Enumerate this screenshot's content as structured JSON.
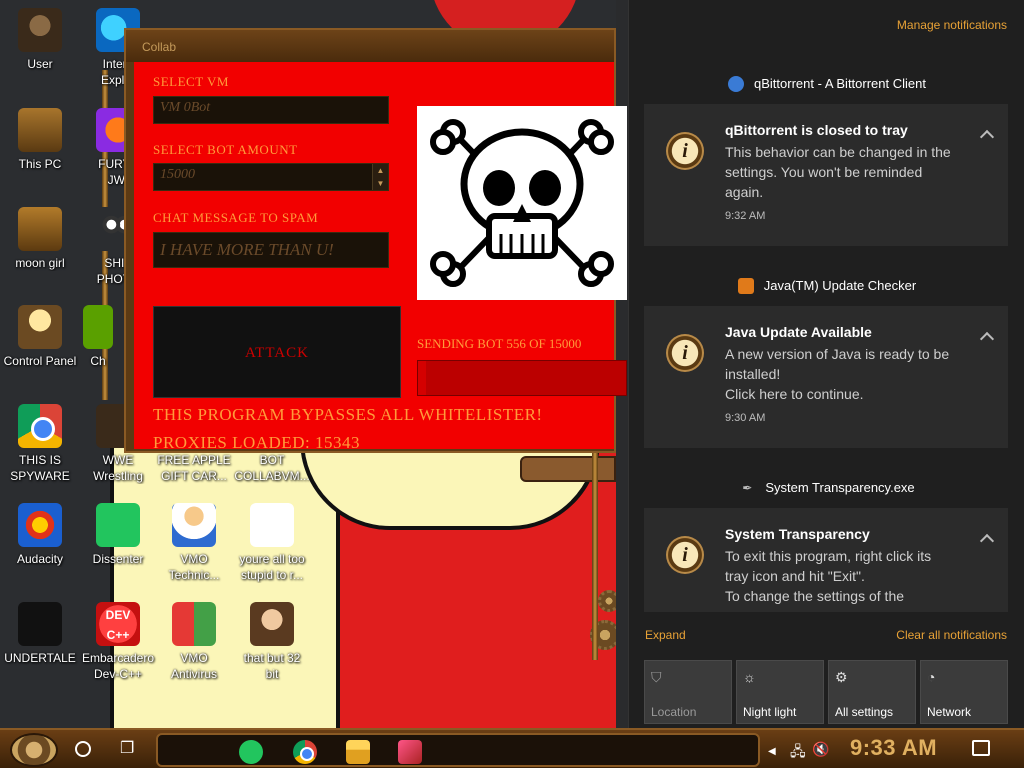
{
  "desktop": {
    "icons": [
      {
        "label": "User"
      },
      {
        "label": "Intern\nExplor"
      },
      {
        "label": "This PC"
      },
      {
        "label": "FURYF\nJWI"
      },
      {
        "label": "moon girl"
      },
      {
        "label": "SHIT\nPHOTO"
      },
      {
        "label": "Control Panel"
      },
      {
        "label": "Ch"
      },
      {
        "label": "THIS IS\nSPYWARE"
      },
      {
        "label": "WWE\nWrestling"
      },
      {
        "label": "FREE APPLE\nGIFT CAR..."
      },
      {
        "label": "BOT\nCOLLABVM..."
      },
      {
        "label": "Audacity"
      },
      {
        "label": "Dissenter"
      },
      {
        "label": "VMO\nTechnic..."
      },
      {
        "label": "youre all too\nstupid to r..."
      },
      {
        "label": "UNDERTALE"
      },
      {
        "label": "Embarcadero\nDev-C++"
      },
      {
        "label": "VMO\nAntivirus"
      },
      {
        "label": "that but 32\nbit"
      }
    ],
    "dev_icon_text": "DEV\nC++"
  },
  "botwin": {
    "title": "Collab",
    "select_vm_label": "SELECT VM",
    "select_vm_value": "VM 0Bot",
    "bot_amount_label": "SELECT BOT AMOUNT",
    "bot_amount_value": "15000",
    "chat_label": "CHAT MESSAGE TO SPAM",
    "chat_value": "I HAVE MORE THAN U!",
    "attack_label": "ATTACK",
    "sending_text": "SENDING BOT 556 OF 15000",
    "progress": 0.037,
    "bypass_text": "THIS PROGRAM BYPASSES ALL WHITELISTER!",
    "proxies_text": "PROXIES LOADED: 15343"
  },
  "action_center": {
    "manage": "Manage notifications",
    "groups": [
      {
        "app": "qBittorrent - A Bittorrent Client",
        "color": "#3a7bd5",
        "title": "qBittorrent is closed to tray",
        "body": "This behavior can be changed in the\nsettings. You won't be reminded\nagain.",
        "time": "9:32 AM"
      },
      {
        "app": "Java(TM) Update Checker",
        "color": "#e07a1a",
        "title": "Java Update Available",
        "body": "A new version of Java is ready to be\ninstalled!\nClick here to continue.",
        "time": "9:30 AM"
      },
      {
        "app": "System Transparency.exe",
        "color": "#1f1f1f",
        "title": "System Transparency",
        "body": "To exit this program, right click its\ntray icon and hit \"Exit\".\nTo change the settings of the",
        "time": ""
      }
    ],
    "expand": "Expand",
    "clear_all": "Clear all notifications",
    "quick_actions": [
      {
        "label": "Location",
        "icon": "location-icon",
        "state": "off"
      },
      {
        "label": "Night light",
        "icon": "night-light-icon",
        "state": "on"
      },
      {
        "label": "All settings",
        "icon": "gear-icon",
        "state": "on"
      },
      {
        "label": "Network",
        "icon": "network-icon",
        "state": "on"
      }
    ]
  },
  "taskbar": {
    "clock": "9:33 AM"
  }
}
